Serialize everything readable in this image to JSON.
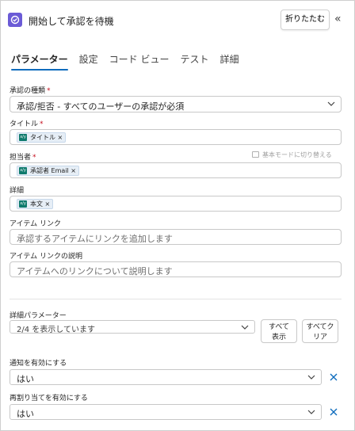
{
  "header": {
    "title": "開始して承認を待機",
    "collapse_label": "折りたたむ",
    "expand_glyph": "«"
  },
  "tabs": [
    {
      "label": "パラメーター",
      "active": true
    },
    {
      "label": "設定",
      "active": false
    },
    {
      "label": "コード ビュー",
      "active": false
    },
    {
      "label": "テスト",
      "active": false
    },
    {
      "label": "詳細",
      "active": false
    }
  ],
  "approval_type": {
    "label": "承認の種類",
    "required_mark": "*",
    "value": "承認/拒否 - すべてのユーザーの承認が必須"
  },
  "title_field": {
    "label": "タイトル",
    "required_mark": "*",
    "token": "タイトル ×",
    "token_icon": "x/y"
  },
  "assignee": {
    "label": "担当者",
    "required_mark": "*",
    "token": "承認者 Email ×",
    "token_icon": "x/y",
    "switch_mode_label": "基本モードに切り替える"
  },
  "details": {
    "label": "詳細",
    "token": "本文 ×",
    "token_icon": "x/y"
  },
  "item_link": {
    "label": "アイテム リンク",
    "placeholder": "承認するアイテムにリンクを追加します"
  },
  "item_link_desc": {
    "label": "アイテム リンクの説明",
    "placeholder": "アイテムへのリンクについて説明します"
  },
  "advanced": {
    "label": "詳細パラメーター",
    "select_value": "2/4 を表示しています",
    "show_all_line1": "すべて",
    "show_all_line2": "表示",
    "clear_all_line1": "すべてク",
    "clear_all_line2": "リア"
  },
  "notifications": {
    "label": "通知を有効にする",
    "value": "はい"
  },
  "reassignment": {
    "label": "再割り当てを有効にする",
    "value": "はい"
  },
  "colors": {
    "accent": "#0f6cbd",
    "app_icon": "#6b5bd6",
    "token_icon": "#0e7a6d",
    "remove_x": "#0f6cbd",
    "required": "#c50f1f"
  }
}
